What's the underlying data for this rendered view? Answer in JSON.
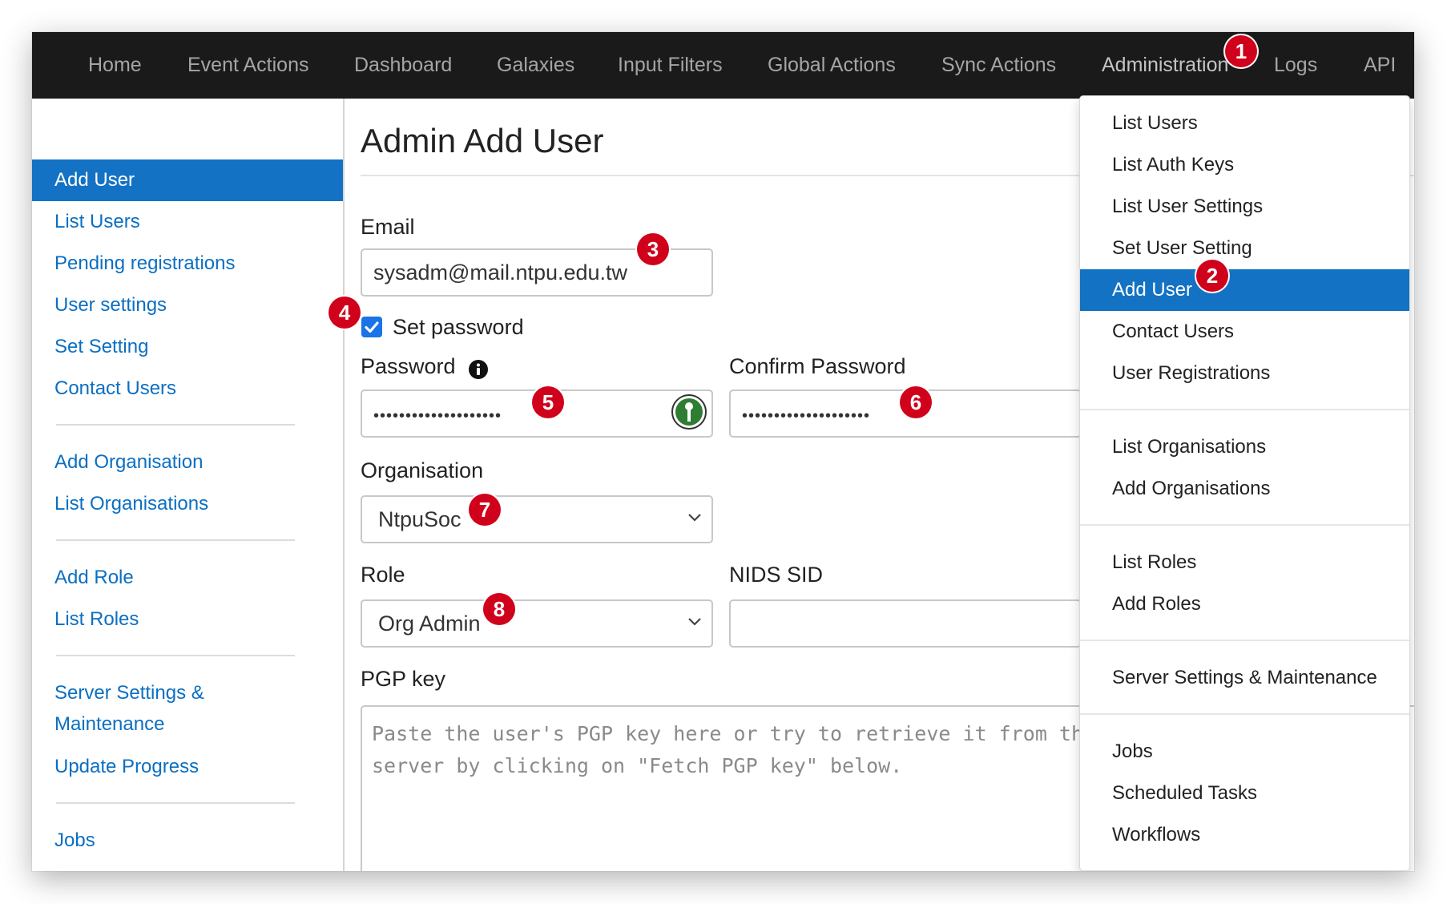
{
  "nav": {
    "items": [
      "Home",
      "Event Actions",
      "Dashboard",
      "Galaxies",
      "Input Filters",
      "Global Actions",
      "Sync Actions",
      "Administration",
      "Logs",
      "API"
    ]
  },
  "sidebar": {
    "items": [
      "Add User",
      "List Users",
      "Pending registrations",
      "User settings",
      "Set Setting",
      "Contact Users",
      "Add Organisation",
      "List Organisations",
      "Add Role",
      "List Roles",
      "Server Settings & Maintenance",
      "Update Progress",
      "Jobs"
    ],
    "active": "Add User"
  },
  "main": {
    "title": "Admin Add User",
    "email_label": "Email",
    "email_value": "sysadm@mail.ntpu.edu.tw",
    "set_password_label": "Set password",
    "set_password_checked": true,
    "password_label": "Password",
    "password_value": "••••••••••••••••••••",
    "confirm_password_label": "Confirm Password",
    "confirm_password_value": "••••••••••••••••••••",
    "organisation_label": "Organisation",
    "organisation_value": "NtpuSoc",
    "role_label": "Role",
    "role_value": "Org Admin",
    "nids_label": "NIDS SID",
    "nids_value": "",
    "pgp_label": "PGP key",
    "pgp_placeholder": "Paste the user's PGP key here or try to retrieve it from the C\nserver by clicking on \"Fetch PGP key\" below."
  },
  "dropdown": {
    "items": [
      "List Users",
      "List Auth Keys",
      "List User Settings",
      "Set User Setting",
      "Add User",
      "Contact Users",
      "User Registrations",
      "List Organisations",
      "Add Organisations",
      "List Roles",
      "Add Roles",
      "Server Settings & Maintenance",
      "Jobs",
      "Scheduled Tasks",
      "Workflows"
    ],
    "active": "Add User"
  },
  "badges": [
    "1",
    "2",
    "3",
    "4",
    "5",
    "6",
    "7",
    "8"
  ],
  "colors": {
    "nav_bg": "#1a1a1a",
    "nav_text": "#a5a5a5",
    "active_bg": "#1472c4",
    "link": "#0b6fc2",
    "badge": "#d0021b",
    "checkbox": "#1a73e8"
  },
  "icons": {
    "info": "info-circle-icon",
    "password_key": "key-circle-icon",
    "select_chevron": "chevron-down-icon",
    "checkbox": "checkmark-icon"
  }
}
